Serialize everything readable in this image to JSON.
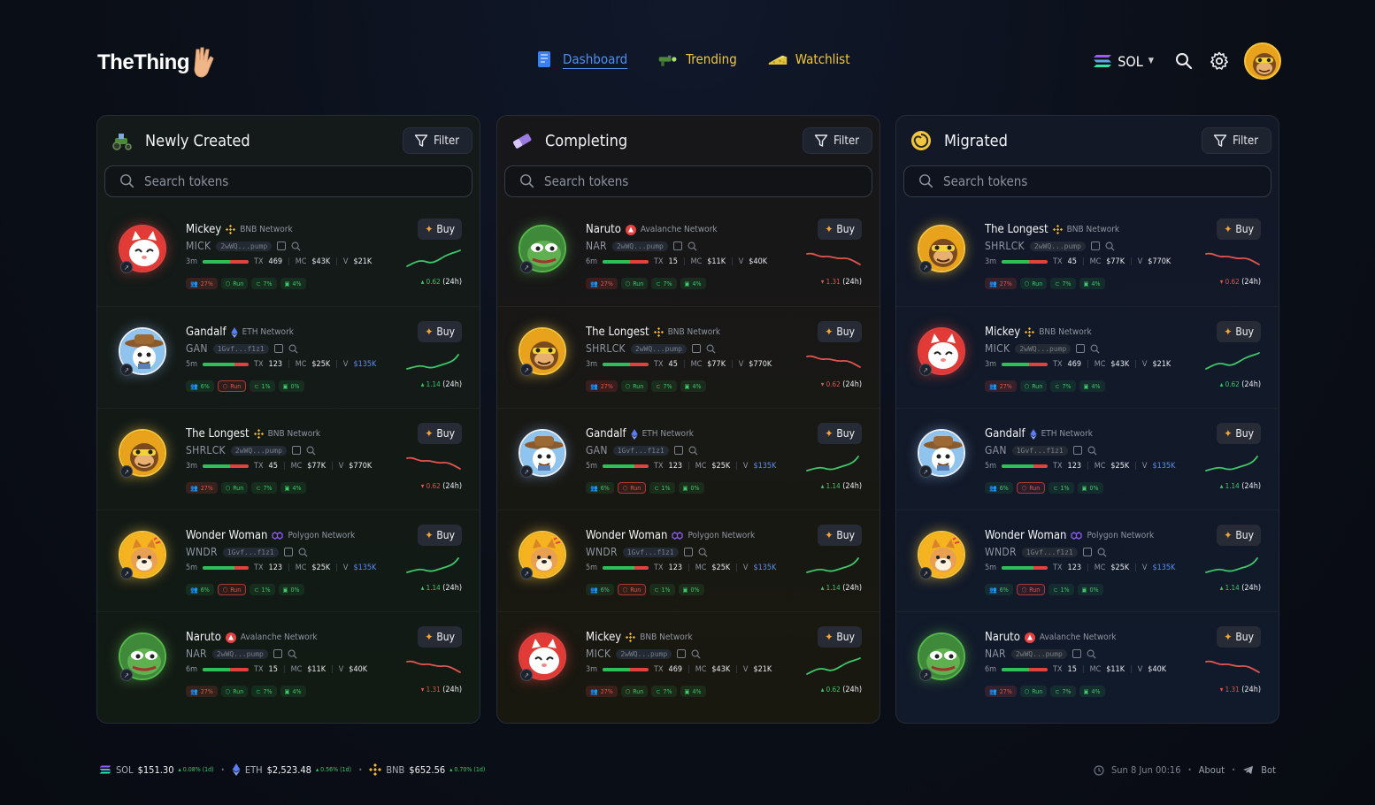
{
  "brand": {
    "name": "TheThing"
  },
  "nav": [
    {
      "label": "Dashboard",
      "icon": "dashboard-icon",
      "active": true
    },
    {
      "label": "Trending",
      "icon": "trending-icon",
      "active": false
    },
    {
      "label": "Watchlist",
      "icon": "watchlist-icon",
      "active": false
    }
  ],
  "chain_selector": {
    "value": "SOL"
  },
  "filter_label": "Filter",
  "search_placeholder": "Search tokens",
  "colors": {
    "accent_yellow": "#f3c73d",
    "link_blue": "#4d8ff0",
    "up_green": "#3fc76a",
    "down_red": "#e2544f"
  },
  "panels": [
    {
      "title": "Newly Created",
      "rows": [
        {
          "name": "Mickey",
          "network": "BNB Network",
          "symbol": "MICK",
          "addr": "2wWQ...pump",
          "age": "3m",
          "tx": "469",
          "mc": "$43K",
          "vol": "$21K",
          "vol_blue": false,
          "tags": [
            "27%",
            "Run",
            "7%",
            "4%"
          ],
          "tags_alt": false,
          "change": "0.62",
          "period": "(24h)",
          "up": true,
          "avatar": "cat"
        },
        {
          "name": "Gandalf",
          "network": "ETH Network",
          "symbol": "GAN",
          "addr": "1Gvf...f1z1",
          "age": "5m",
          "tx": "123",
          "mc": "$25K",
          "vol": "$135K",
          "vol_blue": true,
          "tags": [
            "6%",
            "Run",
            "1%",
            "0%"
          ],
          "tags_alt": true,
          "change": "1.14",
          "period": "(24h)",
          "up": true,
          "avatar": "cowboy"
        },
        {
          "name": "The Longest",
          "network": "BNB Network",
          "symbol": "SHRLCK",
          "addr": "2wWQ...pump",
          "age": "3m",
          "tx": "45",
          "mc": "$77K",
          "vol": "$770K",
          "vol_blue": false,
          "tags": [
            "27%",
            "Run",
            "7%",
            "4%"
          ],
          "tags_alt": false,
          "change": "0.62",
          "period": "(24h)",
          "up": false,
          "avatar": "monkey"
        },
        {
          "name": "Wonder Woman",
          "network": "Polygon Network",
          "symbol": "WNDR",
          "addr": "1Gvf...f1z1",
          "age": "5m",
          "tx": "123",
          "mc": "$25K",
          "vol": "$135K",
          "vol_blue": true,
          "tags": [
            "6%",
            "Run",
            "1%",
            "0%"
          ],
          "tags_alt": true,
          "change": "1.14",
          "period": "(24h)",
          "up": true,
          "avatar": "doge"
        },
        {
          "name": "Naruto",
          "network": "Avalanche Network",
          "symbol": "NAR",
          "addr": "2wWQ...pump",
          "age": "6m",
          "tx": "15",
          "mc": "$11K",
          "vol": "$40K",
          "vol_blue": false,
          "tags": [
            "27%",
            "Run",
            "7%",
            "4%"
          ],
          "tags_alt": false,
          "change": "1.31",
          "period": "(24h)",
          "up": false,
          "avatar": "pepe"
        }
      ]
    },
    {
      "title": "Completing",
      "rows": [
        {
          "name": "Naruto",
          "network": "Avalanche Network",
          "symbol": "NAR",
          "addr": "2wWQ...pump",
          "age": "6m",
          "tx": "15",
          "mc": "$11K",
          "vol": "$40K",
          "vol_blue": false,
          "tags": [
            "27%",
            "Run",
            "7%",
            "4%"
          ],
          "tags_alt": false,
          "change": "1.31",
          "period": "(24h)",
          "up": false,
          "avatar": "pepe"
        },
        {
          "name": "The Longest",
          "network": "BNB Network",
          "symbol": "SHRLCK",
          "addr": "2wWQ...pump",
          "age": "3m",
          "tx": "45",
          "mc": "$77K",
          "vol": "$770K",
          "vol_blue": false,
          "tags": [
            "27%",
            "Run",
            "7%",
            "4%"
          ],
          "tags_alt": false,
          "change": "0.62",
          "period": "(24h)",
          "up": false,
          "avatar": "monkey"
        },
        {
          "name": "Gandalf",
          "network": "ETH Network",
          "symbol": "GAN",
          "addr": "1Gvf...f1z1",
          "age": "5m",
          "tx": "123",
          "mc": "$25K",
          "vol": "$135K",
          "vol_blue": true,
          "tags": [
            "6%",
            "Run",
            "1%",
            "0%"
          ],
          "tags_alt": true,
          "change": "1.14",
          "period": "(24h)",
          "up": true,
          "avatar": "cowboy"
        },
        {
          "name": "Wonder Woman",
          "network": "Polygon Network",
          "symbol": "WNDR",
          "addr": "1Gvf...f1z1",
          "age": "5m",
          "tx": "123",
          "mc": "$25K",
          "vol": "$135K",
          "vol_blue": true,
          "tags": [
            "6%",
            "Run",
            "1%",
            "0%"
          ],
          "tags_alt": true,
          "change": "1.14",
          "period": "(24h)",
          "up": true,
          "avatar": "doge"
        },
        {
          "name": "Mickey",
          "network": "BNB Network",
          "symbol": "MICK",
          "addr": "2wWQ...pump",
          "age": "3m",
          "tx": "469",
          "mc": "$43K",
          "vol": "$21K",
          "vol_blue": false,
          "tags": [
            "27%",
            "Run",
            "7%",
            "4%"
          ],
          "tags_alt": false,
          "change": "0.62",
          "period": "(24h)",
          "up": true,
          "avatar": "cat"
        }
      ]
    },
    {
      "title": "Migrated",
      "rows": [
        {
          "name": "The Longest",
          "network": "BNB Network",
          "symbol": "SHRLCK",
          "addr": "2wWQ...pump",
          "age": "3m",
          "tx": "45",
          "mc": "$77K",
          "vol": "$770K",
          "vol_blue": false,
          "tags": [
            "27%",
            "Run",
            "7%",
            "4%"
          ],
          "tags_alt": false,
          "change": "0.62",
          "period": "(24h)",
          "up": false,
          "avatar": "monkey"
        },
        {
          "name": "Mickey",
          "network": "BNB Network",
          "symbol": "MICK",
          "addr": "2wWQ...pump",
          "age": "3m",
          "tx": "469",
          "mc": "$43K",
          "vol": "$21K",
          "vol_blue": false,
          "tags": [
            "27%",
            "Run",
            "7%",
            "4%"
          ],
          "tags_alt": false,
          "change": "0.62",
          "period": "(24h)",
          "up": true,
          "avatar": "cat"
        },
        {
          "name": "Gandalf",
          "network": "ETH Network",
          "symbol": "GAN",
          "addr": "1Gvf...f1z1",
          "age": "5m",
          "tx": "123",
          "mc": "$25K",
          "vol": "$135K",
          "vol_blue": true,
          "tags": [
            "6%",
            "Run",
            "1%",
            "0%"
          ],
          "tags_alt": true,
          "change": "1.14",
          "period": "(24h)",
          "up": true,
          "avatar": "cowboy"
        },
        {
          "name": "Wonder Woman",
          "network": "Polygon Network",
          "symbol": "WNDR",
          "addr": "1Gvf...f1z1",
          "age": "5m",
          "tx": "123",
          "mc": "$25K",
          "vol": "$135K",
          "vol_blue": true,
          "tags": [
            "6%",
            "Run",
            "1%",
            "0%"
          ],
          "tags_alt": true,
          "change": "1.14",
          "period": "(24h)",
          "up": true,
          "avatar": "doge"
        },
        {
          "name": "Naruto",
          "network": "Avalanche Network",
          "symbol": "NAR",
          "addr": "2wWQ...pump",
          "age": "6m",
          "tx": "15",
          "mc": "$11K",
          "vol": "$40K",
          "vol_blue": false,
          "tags": [
            "27%",
            "Run",
            "7%",
            "4%"
          ],
          "tags_alt": false,
          "change": "1.31",
          "period": "(24h)",
          "up": false,
          "avatar": "pepe"
        }
      ]
    }
  ],
  "row_labels": {
    "tx": "TX",
    "mc": "MC",
    "vol": "V",
    "buy": "Buy"
  },
  "footer": {
    "tickers": [
      {
        "sym": "SOL",
        "price": "$151.30",
        "chg": "0.08% (1d)"
      },
      {
        "sym": "ETH",
        "price": "$2,523.48",
        "chg": "0.56% (1d)"
      },
      {
        "sym": "BNB",
        "price": "$652.56",
        "chg": "0.70% (1d)"
      }
    ],
    "datetime": "Sun 8 Jun 00:16",
    "about": "About",
    "bot": "Bot"
  }
}
